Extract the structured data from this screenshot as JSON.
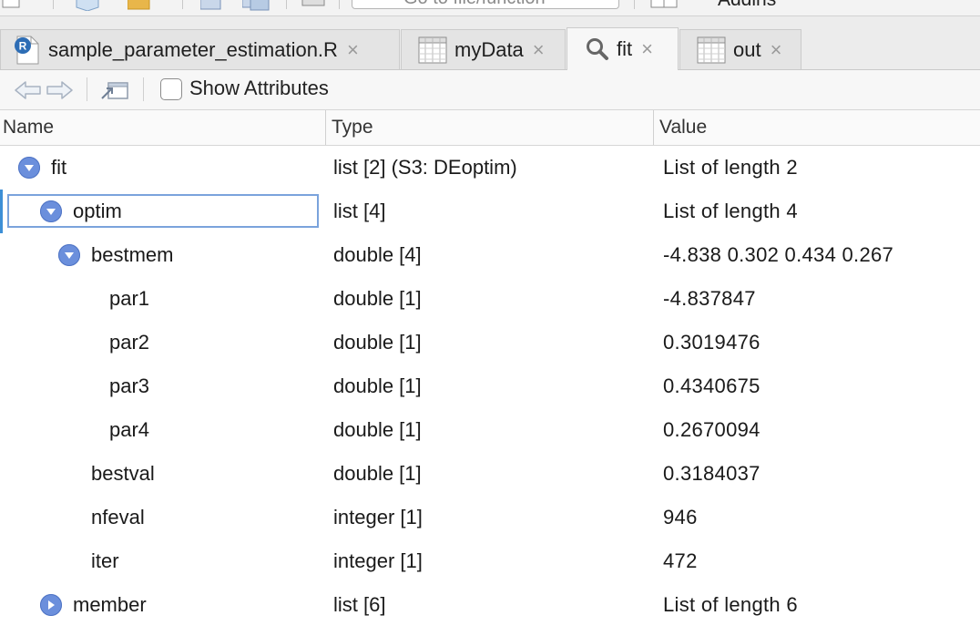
{
  "top_toolbar": {
    "goto_placeholder": "Go to file/function",
    "addins_label": "Addins"
  },
  "tabs": [
    {
      "label": "sample_parameter_estimation.R",
      "icon": "r-file-icon",
      "active": false
    },
    {
      "label": "myData",
      "icon": "grid-table-icon",
      "active": false
    },
    {
      "label": "fit",
      "icon": "magnifier-icon",
      "active": true
    },
    {
      "label": "out",
      "icon": "grid-table-icon",
      "active": false
    }
  ],
  "tab_close_glyph": "×",
  "toolbar": {
    "show_attributes_label": "Show Attributes",
    "show_attributes_checked": false
  },
  "columns": {
    "name": "Name",
    "type": "Type",
    "value": "Value"
  },
  "rows": [
    {
      "name": "fit",
      "type": "list [2] (S3: DEoptim)",
      "value": "List of length 2",
      "toggle": "expanded"
    },
    {
      "name": "optim",
      "type": "list [4]",
      "value": "List of length 4",
      "toggle": "expanded",
      "selected": true
    },
    {
      "name": "bestmem",
      "type": "double [4]",
      "value": "-4.838 0.302 0.434 0.267",
      "toggle": "expanded"
    },
    {
      "name": "par1",
      "type": "double [1]",
      "value": "-4.837847"
    },
    {
      "name": "par2",
      "type": "double [1]",
      "value": "0.3019476"
    },
    {
      "name": "par3",
      "type": "double [1]",
      "value": "0.4340675"
    },
    {
      "name": "par4",
      "type": "double [1]",
      "value": "0.2670094"
    },
    {
      "name": "bestval",
      "type": "double [1]",
      "value": "0.3184037"
    },
    {
      "name": "nfeval",
      "type": "integer [1]",
      "value": "946"
    },
    {
      "name": "iter",
      "type": "integer [1]",
      "value": "472"
    },
    {
      "name": "member",
      "type": "list [6]",
      "value": "List of length 6",
      "toggle": "collapsed"
    }
  ],
  "colors": {
    "toggle_blue": "#6b8fdc",
    "selection_border": "#7aa3dc",
    "selection_bar": "#3d8fd6"
  }
}
